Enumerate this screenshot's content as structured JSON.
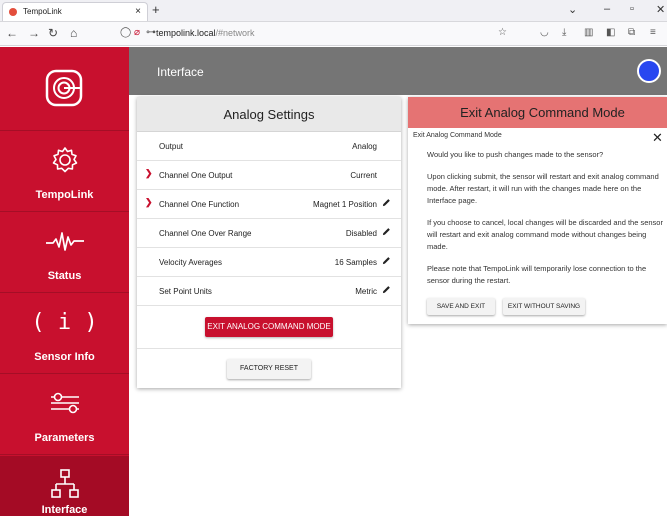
{
  "browser": {
    "tab_title": "TempoLink",
    "url_host": "tempolink.local",
    "url_path": "/#network"
  },
  "sidebar": {
    "items": [
      {
        "label": "TempoLink",
        "icon": "gear-icon"
      },
      {
        "label": "Status",
        "icon": "pulse-icon"
      },
      {
        "label": "Sensor Info",
        "icon": "info-icon"
      },
      {
        "label": "Parameters",
        "icon": "sliders-icon"
      },
      {
        "label": "Interface",
        "icon": "network-icon"
      }
    ],
    "active": "Interface"
  },
  "header": {
    "title": "Interface"
  },
  "analog": {
    "title": "Analog Settings",
    "rows": [
      {
        "name": "Output",
        "value": "Analog"
      },
      {
        "name": "Channel One Output",
        "value": "Current"
      },
      {
        "name": "Channel One Function",
        "value": "Magnet 1 Position"
      },
      {
        "name": "Channel One Over Range",
        "value": "Disabled"
      },
      {
        "name": "Velocity Averages",
        "value": "16 Samples"
      },
      {
        "name": "Set Point Units",
        "value": "Metric"
      }
    ],
    "exit_button": "EXIT ANALOG COMMAND MODE",
    "factory_reset": "FACTORY RESET"
  },
  "dialog": {
    "title": "Exit Analog Command Mode",
    "subtitle": "Exit Analog Command Mode",
    "p1": "Would you like to push changes made to the sensor?",
    "p2": "Upon clicking submit, the sensor will restart and exit analog command mode. After restart, it will run with the changes made here on the Interface page.",
    "p3": "If you choose to cancel, local changes will be discarded and the sensor will restart and exit analog command mode without changes being made.",
    "p4": "Please note that TempoLink will temporarily lose connection to the sensor during the restart.",
    "save_button": "SAVE AND EXIT",
    "nosave_button": "EXIT WITHOUT SAVING"
  },
  "colors": {
    "brand_red": "#c8102e",
    "dialog_header": "#e57373",
    "header_gray": "#757575",
    "avatar_blue": "#2847f0"
  }
}
